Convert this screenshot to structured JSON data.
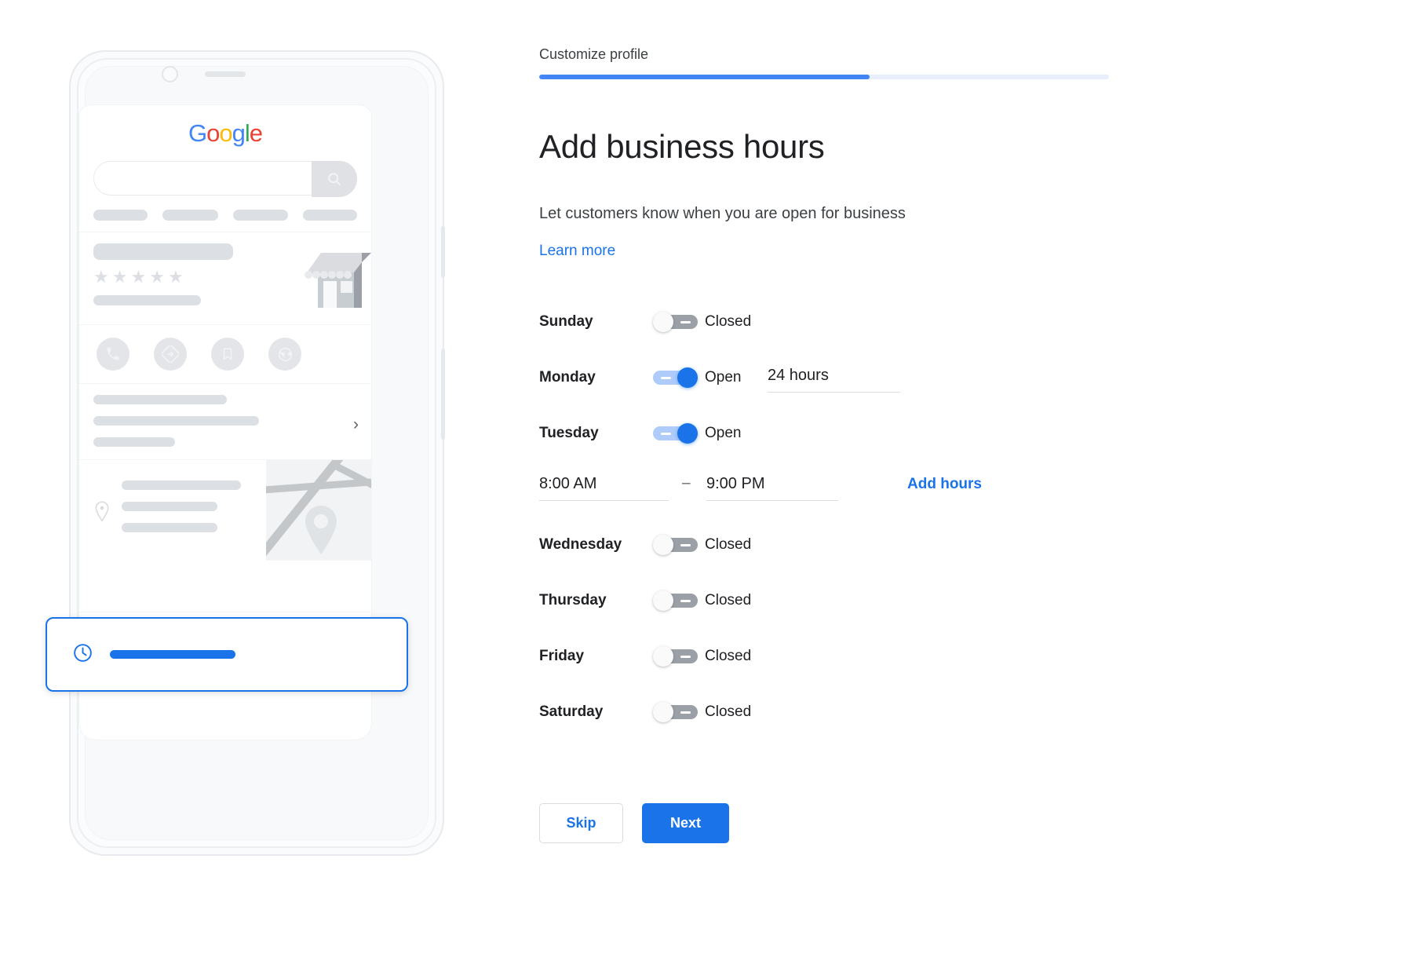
{
  "step": {
    "label": "Customize profile",
    "progress_percent": 58,
    "fill_color": "#4285f4",
    "track_color": "#e8eefb"
  },
  "heading": {
    "title": "Add business hours",
    "subtitle": "Let customers know when you are open for business",
    "learn_more": "Learn more"
  },
  "hours": {
    "state_open": "Open",
    "state_closed": "Closed",
    "separator": "–",
    "add_hours_label": "Add hours",
    "days": [
      {
        "name": "Sunday",
        "state": "Closed"
      },
      {
        "name": "Monday",
        "state": "Open",
        "value": "24 hours"
      },
      {
        "name": "Tuesday",
        "state": "Open",
        "open_time": "8:00 AM",
        "close_time": "9:00 PM"
      },
      {
        "name": "Wednesday",
        "state": "Closed"
      },
      {
        "name": "Thursday",
        "state": "Closed"
      },
      {
        "name": "Friday",
        "state": "Closed"
      },
      {
        "name": "Saturday",
        "state": "Closed"
      }
    ]
  },
  "footer": {
    "skip_label": "Skip",
    "next_label": "Next"
  },
  "phone_preview": {
    "google_logo": {
      "letters": [
        "G",
        "o",
        "o",
        "g",
        "l",
        "e"
      ],
      "colors": [
        "#4285F4",
        "#EA4335",
        "#FBBC05",
        "#4285F4",
        "#34A853",
        "#EA4335"
      ]
    },
    "icons": {
      "search": "search-icon",
      "call": "phone-icon",
      "directions": "directions-icon",
      "save": "bookmark-icon",
      "website": "globe-icon",
      "location": "map-pin-icon",
      "hours": "clock-icon",
      "chevron": "chevron-right-icon",
      "storefront": "storefront-icon"
    },
    "rating_stars": 5,
    "highlight_color": "#1a73e8"
  },
  "colors": {
    "accent": "#1a73e8",
    "google_blue": "#4285f4",
    "text_primary": "#202124",
    "text_secondary": "#3c4043",
    "placeholder_gray": "#dcdfe3",
    "toggle_off": "#9aa0a6",
    "toggle_on_track": "#aecbfa"
  }
}
